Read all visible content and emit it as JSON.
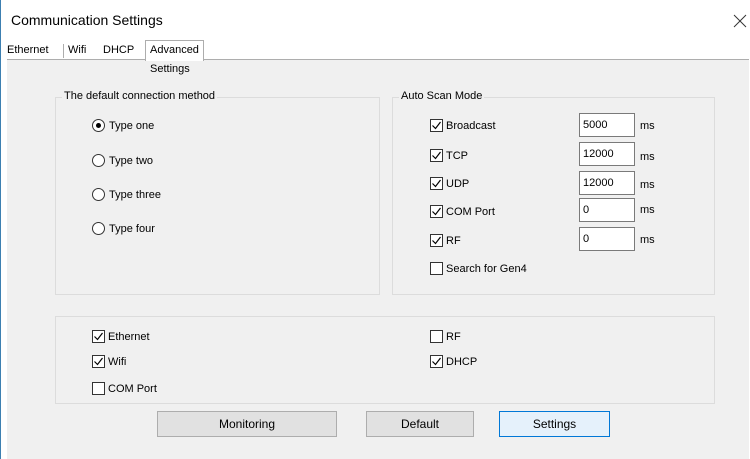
{
  "window": {
    "title": "Communication Settings"
  },
  "tabs": [
    {
      "label": "Ethernet"
    },
    {
      "label": "Wifi"
    },
    {
      "label": "DHCP"
    },
    {
      "label": "Advanced Settings",
      "active": true
    }
  ],
  "connection_group": {
    "title": "The default connection method",
    "options": [
      {
        "label": "Type one",
        "selected": true
      },
      {
        "label": "Type two",
        "selected": false
      },
      {
        "label": "Type three",
        "selected": false
      },
      {
        "label": "Type four",
        "selected": false
      }
    ]
  },
  "scan_group": {
    "title": "Auto Scan Mode",
    "items": [
      {
        "label": "Broadcast",
        "checked": true,
        "value": "5000",
        "unit": "ms"
      },
      {
        "label": "TCP",
        "checked": true,
        "value": "12000",
        "unit": "ms"
      },
      {
        "label": "UDP",
        "checked": true,
        "value": "12000",
        "unit": "ms"
      },
      {
        "label": "COM Port",
        "checked": true,
        "value": "0",
        "unit": "ms"
      },
      {
        "label": "RF",
        "checked": true,
        "value": "0",
        "unit": "ms"
      }
    ],
    "gen4": {
      "label": "Search for Gen4",
      "checked": false
    }
  },
  "interfaces_group": {
    "items": [
      {
        "label": "Ethernet",
        "checked": true
      },
      {
        "label": "Wifi",
        "checked": true
      },
      {
        "label": "COM Port",
        "checked": false
      },
      {
        "label": "RF",
        "checked": false
      },
      {
        "label": "DHCP",
        "checked": true
      }
    ]
  },
  "buttons": {
    "monitoring": "Monitoring",
    "default": "Default",
    "settings": "Settings"
  },
  "colors": {
    "accent": "#0078d7",
    "panel_bg": "#f0f0f0",
    "button_bg": "#e1e1e1"
  }
}
